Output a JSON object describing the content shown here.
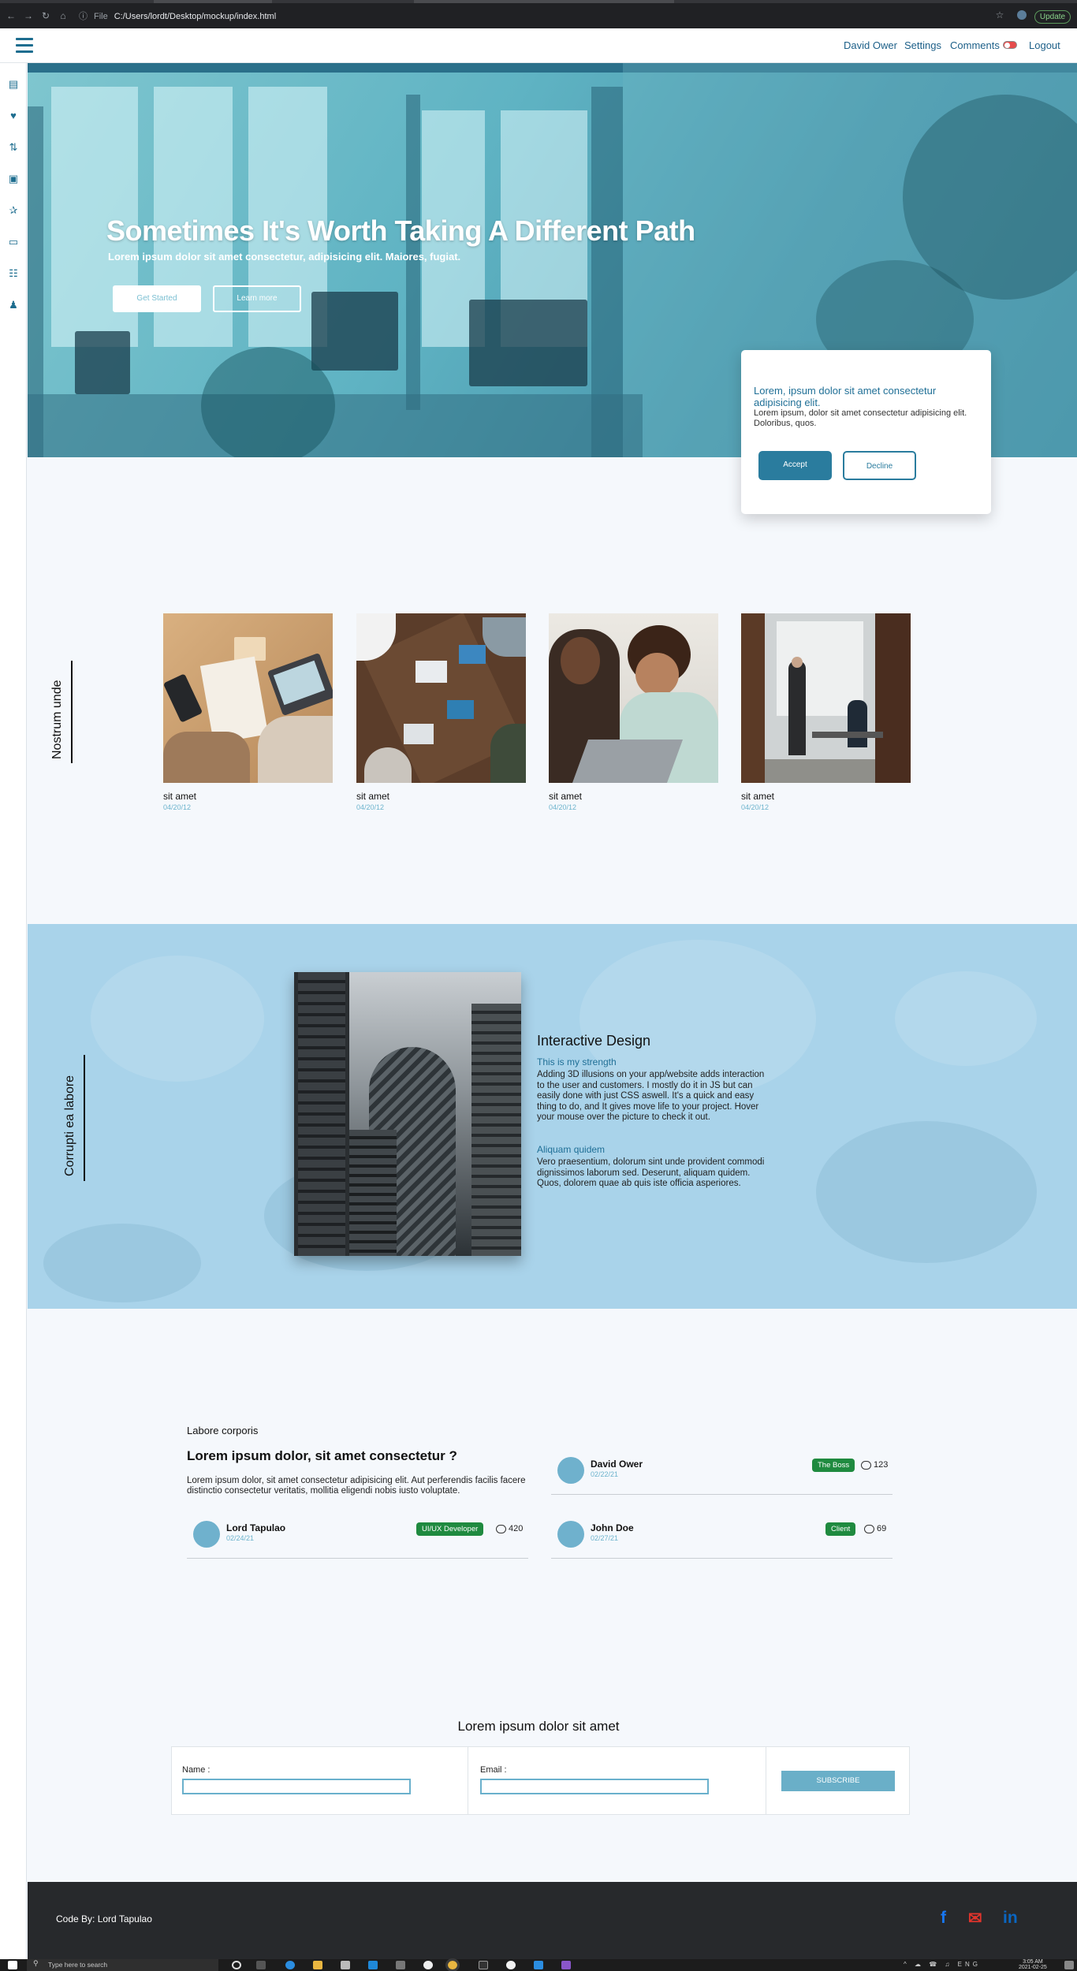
{
  "browser": {
    "scheme_label": "File",
    "url": "C:/Users/lordt/Desktop/mockup/index.html",
    "update_label": "Update"
  },
  "topnav": {
    "user": "David Ower",
    "settings": "Settings",
    "comments": "Comments",
    "logout": "Logout"
  },
  "sidebar_icons": [
    "book-icon",
    "heart-icon",
    "sort-icon",
    "photos-icon",
    "running-icon",
    "id-card-icon",
    "sitemap-icon",
    "users-icon"
  ],
  "hero": {
    "title": "Sometimes It's Worth Taking A Different Path",
    "subtitle": "Lorem ipsum dolor sit amet consectetur, adipisicing elit. Maiores, fugiat.",
    "get_started": "Get Started",
    "learn_more": "Learn more"
  },
  "cookie": {
    "title": "Lorem, ipsum dolor sit amet consectetur adipisicing elit.",
    "text": "Lorem ipsum, dolor sit amet consectetur adipisicing elit. Doloribus, quos.",
    "accept": "Accept",
    "decline": "Decline"
  },
  "gallery": {
    "label": "Nostrum unde",
    "cards": [
      {
        "title": "sit amet",
        "date": "04/20/12"
      },
      {
        "title": "sit amet",
        "date": "04/20/12"
      },
      {
        "title": "sit amet",
        "date": "04/20/12"
      },
      {
        "title": "sit amet",
        "date": "04/20/12"
      }
    ]
  },
  "feature": {
    "label": "Corrupti ea labore",
    "title": "Interactive Design",
    "sub1": "This is my strength",
    "text1": "Adding 3D illusions on your app/website adds interaction to the user and customers. I mostly do it in JS but can easily done with just CSS aswell. It's a quick and easy thing to do, and It gives move life to your project. Hover your mouse over the picture to check it out.",
    "sub2": "Aliquam quidem",
    "text2": "Vero praesentium, dolorum sint unde provident commodi dignissimos laborum sed. Deserunt, aliquam quidem. Quos, dolorem quae ab quis iste officia asperiores."
  },
  "testimonials": {
    "small_title": "Labore corporis",
    "title": "Lorem ipsum dolor, sit amet consectetur ?",
    "text": "Lorem ipsum dolor, sit amet consectetur adipisicing elit. Aut perferendis facilis facere distinctio consectetur veritatis, mollitia eligendi nobis iusto voluptate.",
    "people": [
      {
        "name": "Lord Tapulao",
        "date": "02/24/21",
        "badge": "UI/UX Developer",
        "comments": "420"
      },
      {
        "name": "David Ower",
        "date": "02/22/21",
        "badge": "The Boss",
        "comments": "123"
      },
      {
        "name": "John Doe",
        "date": "02/27/21",
        "badge": "Client",
        "comments": "69"
      }
    ]
  },
  "subscribe": {
    "title": "Lorem ipsum dolor sit amet",
    "name_label": "Name :",
    "email_label": "Email :",
    "button": "SUBSCRIBE"
  },
  "footer": {
    "credit": "Code By: Lord Tapulao",
    "social": [
      "f",
      "✉",
      "in"
    ]
  },
  "taskbar": {
    "search_placeholder": "Type here to search",
    "lang": "ENG",
    "time": "3:05 AM",
    "date": "2021-02-25"
  },
  "colors": {
    "accent": "#1f6f96",
    "accent_button": "#2a7c9e",
    "badge_green": "#1f8a3f",
    "section_blue": "#a9d3ea",
    "footer": "#27292c"
  }
}
